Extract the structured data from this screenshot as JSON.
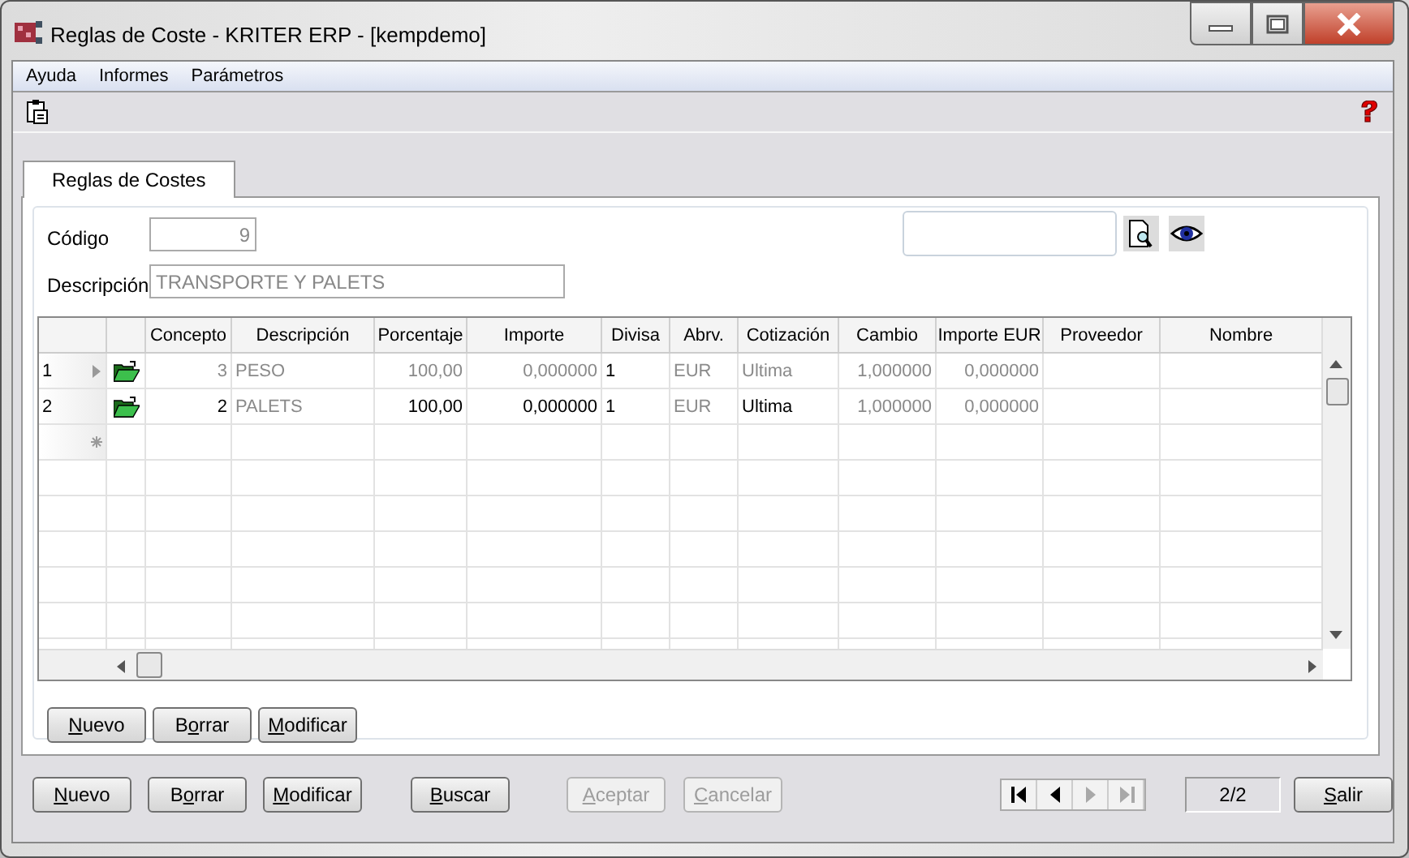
{
  "window": {
    "title": "Reglas de Coste - KRITER ERP - [kempdemo]"
  },
  "menu": [
    "Ayuda",
    "Informes",
    "Parámetros"
  ],
  "tabs": [
    {
      "label": "Reglas de Costes",
      "selected": true
    }
  ],
  "form": {
    "codigo": {
      "label": "Código",
      "value": "9"
    },
    "descripcion": {
      "label": "Descripción",
      "value": "TRANSPORTE Y PALETS"
    }
  },
  "grid": {
    "columns": [
      "Concepto",
      "Descripción",
      "Porcentaje",
      "Importe",
      "Divisa",
      "Abrv.",
      "Cotización",
      "Cambio",
      "Importe EUR",
      "Proveedor",
      "Nombre"
    ],
    "rows": [
      {
        "number": "1",
        "current": true,
        "cells": [
          {
            "text": "3",
            "dim": true
          },
          {
            "text": "PESO",
            "dim": true
          },
          {
            "text": "100,00",
            "dim": true
          },
          {
            "text": "0,000000",
            "dim": true
          },
          {
            "text": "1",
            "dim": false
          },
          {
            "text": "EUR",
            "dim": true
          },
          {
            "text": "Ultima",
            "dim": true
          },
          {
            "text": "1,000000",
            "dim": true
          },
          {
            "text": "0,000000",
            "dim": true
          }
        ]
      },
      {
        "number": "2",
        "current": false,
        "cells": [
          {
            "text": "2",
            "dim": false
          },
          {
            "text": "PALETS",
            "dim": true
          },
          {
            "text": "100,00",
            "dim": false
          },
          {
            "text": "0,000000",
            "dim": false
          },
          {
            "text": "1",
            "dim": false
          },
          {
            "text": "EUR",
            "dim": true
          },
          {
            "text": "Ultima",
            "dim": false
          },
          {
            "text": "1,000000",
            "dim": true
          },
          {
            "text": "0,000000",
            "dim": true
          }
        ]
      }
    ]
  },
  "grid_buttons": [
    {
      "label": {
        "key": "N",
        "after": "uevo"
      }
    },
    {
      "label": {
        "before": "B",
        "key": "o",
        "after": "rrar"
      }
    },
    {
      "label": {
        "key": "M",
        "after": "odificar"
      }
    }
  ],
  "buttons": [
    {
      "label": {
        "key": "N",
        "after": "uevo"
      },
      "disabled": false
    },
    {
      "label": {
        "before": "B",
        "key": "o",
        "after": "rrar"
      },
      "disabled": false
    },
    {
      "label": {
        "key": "M",
        "after": "odificar"
      },
      "disabled": false
    },
    {
      "label": {
        "key": "B",
        "after": "uscar"
      },
      "disabled": false
    },
    {
      "label": {
        "key": "A",
        "after": "ceptar"
      },
      "disabled": true
    },
    {
      "label": {
        "key": "C",
        "after": "ancelar"
      },
      "disabled": true
    }
  ],
  "navigator": {
    "buttons": [
      {
        "kind": "first",
        "disabled": false
      },
      {
        "kind": "previous",
        "disabled": false
      },
      {
        "kind": "next",
        "disabled": true
      },
      {
        "kind": "last",
        "disabled": true
      }
    ],
    "position": "2/2"
  },
  "exit_button": {
    "label": {
      "key": "S",
      "after": "alir"
    }
  }
}
